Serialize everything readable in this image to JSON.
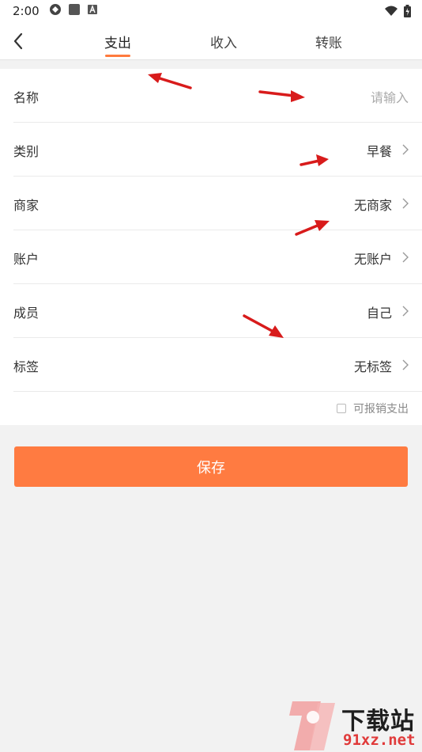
{
  "status_bar": {
    "time": "2:00",
    "icons": [
      "sync-icon",
      "stop-square-icon",
      "a-badge-icon"
    ],
    "right_icons": [
      "wifi-icon",
      "battery-icon"
    ]
  },
  "header": {
    "back_icon": "chevron-left-icon",
    "tabs": [
      {
        "label": "支出",
        "active": true
      },
      {
        "label": "收入",
        "active": false
      },
      {
        "label": "转账",
        "active": false
      }
    ],
    "accent_color": "#ff7a3d"
  },
  "form": {
    "name": {
      "label": "名称",
      "placeholder": "请输入"
    },
    "rows": [
      {
        "label": "类别",
        "value": "早餐"
      },
      {
        "label": "商家",
        "value": "无商家"
      },
      {
        "label": "账户",
        "value": "无账户"
      },
      {
        "label": "成员",
        "value": "自己"
      },
      {
        "label": "标签",
        "value": "无标签"
      }
    ],
    "reimbursable": {
      "label": "可报销支出",
      "checked": false
    }
  },
  "save_button": {
    "label": "保存",
    "color": "#ff7b41"
  },
  "watermark": {
    "line1": "下载站",
    "line2": "91xz.net"
  }
}
